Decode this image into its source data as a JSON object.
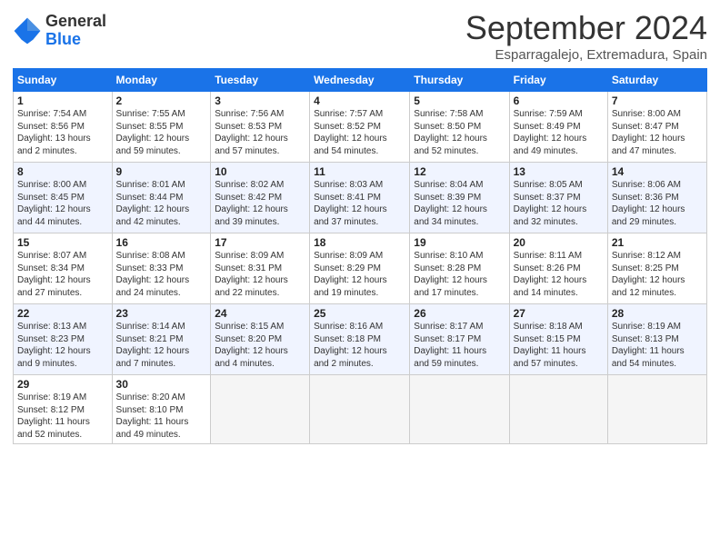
{
  "logo": {
    "line1": "General",
    "line2": "Blue"
  },
  "title": "September 2024",
  "subtitle": "Esparragalejo, Extremadura, Spain",
  "weekdays": [
    "Sunday",
    "Monday",
    "Tuesday",
    "Wednesday",
    "Thursday",
    "Friday",
    "Saturday"
  ],
  "weeks": [
    [
      {
        "day": "1",
        "info": "Sunrise: 7:54 AM\nSunset: 8:56 PM\nDaylight: 13 hours\nand 2 minutes."
      },
      {
        "day": "2",
        "info": "Sunrise: 7:55 AM\nSunset: 8:55 PM\nDaylight: 12 hours\nand 59 minutes."
      },
      {
        "day": "3",
        "info": "Sunrise: 7:56 AM\nSunset: 8:53 PM\nDaylight: 12 hours\nand 57 minutes."
      },
      {
        "day": "4",
        "info": "Sunrise: 7:57 AM\nSunset: 8:52 PM\nDaylight: 12 hours\nand 54 minutes."
      },
      {
        "day": "5",
        "info": "Sunrise: 7:58 AM\nSunset: 8:50 PM\nDaylight: 12 hours\nand 52 minutes."
      },
      {
        "day": "6",
        "info": "Sunrise: 7:59 AM\nSunset: 8:49 PM\nDaylight: 12 hours\nand 49 minutes."
      },
      {
        "day": "7",
        "info": "Sunrise: 8:00 AM\nSunset: 8:47 PM\nDaylight: 12 hours\nand 47 minutes."
      }
    ],
    [
      {
        "day": "8",
        "info": "Sunrise: 8:00 AM\nSunset: 8:45 PM\nDaylight: 12 hours\nand 44 minutes."
      },
      {
        "day": "9",
        "info": "Sunrise: 8:01 AM\nSunset: 8:44 PM\nDaylight: 12 hours\nand 42 minutes."
      },
      {
        "day": "10",
        "info": "Sunrise: 8:02 AM\nSunset: 8:42 PM\nDaylight: 12 hours\nand 39 minutes."
      },
      {
        "day": "11",
        "info": "Sunrise: 8:03 AM\nSunset: 8:41 PM\nDaylight: 12 hours\nand 37 minutes."
      },
      {
        "day": "12",
        "info": "Sunrise: 8:04 AM\nSunset: 8:39 PM\nDaylight: 12 hours\nand 34 minutes."
      },
      {
        "day": "13",
        "info": "Sunrise: 8:05 AM\nSunset: 8:37 PM\nDaylight: 12 hours\nand 32 minutes."
      },
      {
        "day": "14",
        "info": "Sunrise: 8:06 AM\nSunset: 8:36 PM\nDaylight: 12 hours\nand 29 minutes."
      }
    ],
    [
      {
        "day": "15",
        "info": "Sunrise: 8:07 AM\nSunset: 8:34 PM\nDaylight: 12 hours\nand 27 minutes."
      },
      {
        "day": "16",
        "info": "Sunrise: 8:08 AM\nSunset: 8:33 PM\nDaylight: 12 hours\nand 24 minutes."
      },
      {
        "day": "17",
        "info": "Sunrise: 8:09 AM\nSunset: 8:31 PM\nDaylight: 12 hours\nand 22 minutes."
      },
      {
        "day": "18",
        "info": "Sunrise: 8:09 AM\nSunset: 8:29 PM\nDaylight: 12 hours\nand 19 minutes."
      },
      {
        "day": "19",
        "info": "Sunrise: 8:10 AM\nSunset: 8:28 PM\nDaylight: 12 hours\nand 17 minutes."
      },
      {
        "day": "20",
        "info": "Sunrise: 8:11 AM\nSunset: 8:26 PM\nDaylight: 12 hours\nand 14 minutes."
      },
      {
        "day": "21",
        "info": "Sunrise: 8:12 AM\nSunset: 8:25 PM\nDaylight: 12 hours\nand 12 minutes."
      }
    ],
    [
      {
        "day": "22",
        "info": "Sunrise: 8:13 AM\nSunset: 8:23 PM\nDaylight: 12 hours\nand 9 minutes."
      },
      {
        "day": "23",
        "info": "Sunrise: 8:14 AM\nSunset: 8:21 PM\nDaylight: 12 hours\nand 7 minutes."
      },
      {
        "day": "24",
        "info": "Sunrise: 8:15 AM\nSunset: 8:20 PM\nDaylight: 12 hours\nand 4 minutes."
      },
      {
        "day": "25",
        "info": "Sunrise: 8:16 AM\nSunset: 8:18 PM\nDaylight: 12 hours\nand 2 minutes."
      },
      {
        "day": "26",
        "info": "Sunrise: 8:17 AM\nSunset: 8:17 PM\nDaylight: 11 hours\nand 59 minutes."
      },
      {
        "day": "27",
        "info": "Sunrise: 8:18 AM\nSunset: 8:15 PM\nDaylight: 11 hours\nand 57 minutes."
      },
      {
        "day": "28",
        "info": "Sunrise: 8:19 AM\nSunset: 8:13 PM\nDaylight: 11 hours\nand 54 minutes."
      }
    ],
    [
      {
        "day": "29",
        "info": "Sunrise: 8:19 AM\nSunset: 8:12 PM\nDaylight: 11 hours\nand 52 minutes."
      },
      {
        "day": "30",
        "info": "Sunrise: 8:20 AM\nSunset: 8:10 PM\nDaylight: 11 hours\nand 49 minutes."
      },
      {
        "day": "",
        "info": ""
      },
      {
        "day": "",
        "info": ""
      },
      {
        "day": "",
        "info": ""
      },
      {
        "day": "",
        "info": ""
      },
      {
        "day": "",
        "info": ""
      }
    ]
  ]
}
